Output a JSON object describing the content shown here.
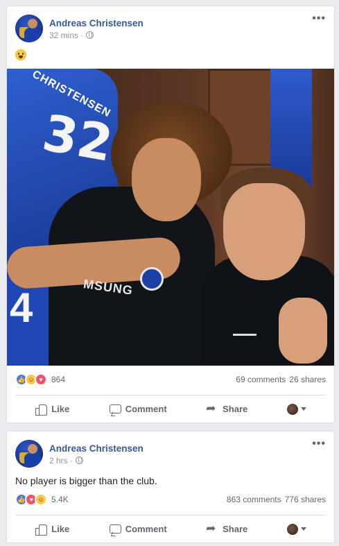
{
  "posts": [
    {
      "author": "Andreas Christensen",
      "time": "32 mins",
      "separator": "·",
      "text_emoji": "grimacing-face-emoji",
      "photo_text": {
        "jersey_name": "CHRISTENSEN",
        "jersey_number": "32",
        "lower_number": "4",
        "sponsor": "MSUNG"
      },
      "reactions": {
        "icons": [
          "like",
          "haha",
          "love"
        ],
        "count": "864"
      },
      "comments": "69 comments",
      "shares": "26 shares",
      "actions": {
        "like": "Like",
        "comment": "Comment",
        "share": "Share"
      }
    },
    {
      "author": "Andreas Christensen",
      "time": "2 hrs",
      "separator": "·",
      "text": "No player is bigger than the club.",
      "reactions": {
        "icons": [
          "like",
          "love",
          "haha"
        ],
        "count": "5.4K"
      },
      "comments": "863 comments",
      "shares": "776 shares",
      "actions": {
        "like": "Like",
        "comment": "Comment",
        "share": "Share"
      }
    }
  ],
  "icons": {
    "more": "more-options-icon",
    "privacy": "globe-icon"
  },
  "colors": {
    "name": "#365899",
    "like": "#4a79e8",
    "love": "#f25268",
    "haha": "#f7c84a",
    "background": "#e9ebee"
  }
}
